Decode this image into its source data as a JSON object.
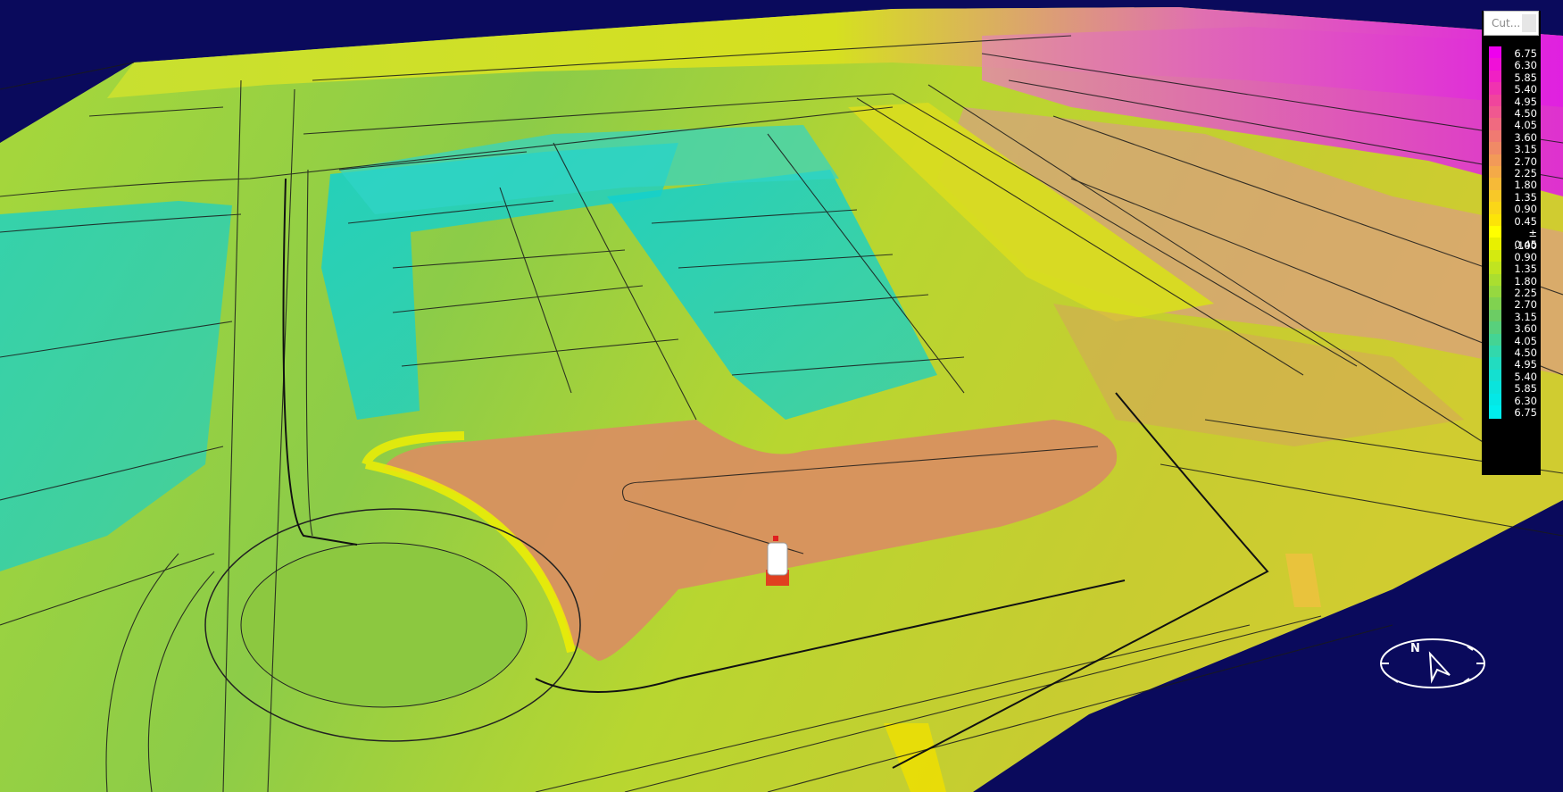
{
  "toolbar": {
    "mode_dropdown_label": "Cut..."
  },
  "legend": {
    "entries": [
      {
        "label": "6.75",
        "color": "#ee00ee"
      },
      {
        "label": "6.30",
        "color": "#f010d8"
      },
      {
        "label": "5.85",
        "color": "#f020c4"
      },
      {
        "label": "5.40",
        "color": "#f033b0"
      },
      {
        "label": "4.95",
        "color": "#f0459c"
      },
      {
        "label": "4.50",
        "color": "#f05890"
      },
      {
        "label": "4.05",
        "color": "#f06a80"
      },
      {
        "label": "3.60",
        "color": "#f07a72"
      },
      {
        "label": "3.15",
        "color": "#f08a66"
      },
      {
        "label": "2.70",
        "color": "#f29a58"
      },
      {
        "label": "2.25",
        "color": "#f4aa48"
      },
      {
        "label": "1.80",
        "color": "#f6ba38"
      },
      {
        "label": "1.35",
        "color": "#f8c828"
      },
      {
        "label": "0.90",
        "color": "#fad618"
      },
      {
        "label": "0.45",
        "color": "#fce408"
      },
      {
        "label": "± .100",
        "color": "#ffff00"
      },
      {
        "label": "0.45",
        "color": "#e8f000"
      },
      {
        "label": "0.90",
        "color": "#d4ea10"
      },
      {
        "label": "1.35",
        "color": "#c0e420"
      },
      {
        "label": "1.80",
        "color": "#aade30"
      },
      {
        "label": "2.25",
        "color": "#96d840"
      },
      {
        "label": "2.70",
        "color": "#80d250"
      },
      {
        "label": "3.15",
        "color": "#6ccc64"
      },
      {
        "label": "3.60",
        "color": "#58d07c"
      },
      {
        "label": "4.05",
        "color": "#44d494"
      },
      {
        "label": "4.50",
        "color": "#32d8ac"
      },
      {
        "label": "4.95",
        "color": "#22dcc0"
      },
      {
        "label": "5.40",
        "color": "#14e0d0"
      },
      {
        "label": "5.85",
        "color": "#0ae4dc"
      },
      {
        "label": "6.30",
        "color": "#04e8e6"
      },
      {
        "label": "6.75",
        "color": "#00eeee"
      }
    ]
  },
  "scene": {
    "background_color": "#0a0a5c",
    "compass_icon": "compass-rose-icon",
    "vehicle_icon": "survey-vehicle-icon"
  }
}
